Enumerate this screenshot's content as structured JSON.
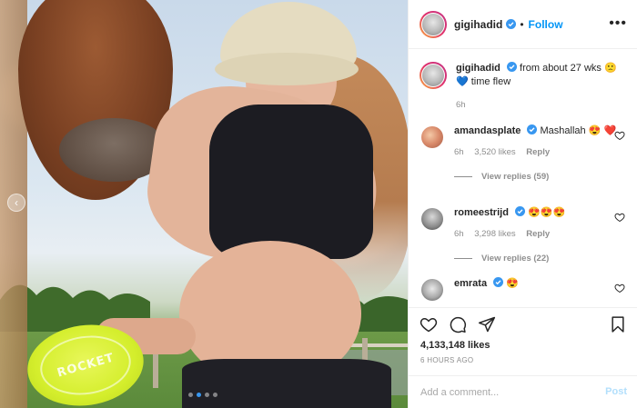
{
  "header": {
    "username": "gigihadid",
    "separator": "•",
    "follow_label": "Follow",
    "more_icon": "more-horizontal-icon"
  },
  "caption": {
    "username": "gigihadid",
    "text": "from about 27 wks 🙁 💙 time flew",
    "time": "6h"
  },
  "comments": [
    {
      "username": "amandasplate",
      "text": "Mashallah 😍 ❤️",
      "time": "6h",
      "likes": "3,520 likes",
      "reply_label": "Reply",
      "replies": "View replies (59)"
    },
    {
      "username": "romeestrijd",
      "text": "😍😍😍",
      "time": "6h",
      "likes": "3,298 likes",
      "reply_label": "Reply",
      "replies": "View replies (22)"
    },
    {
      "username": "emrata",
      "text": "😍"
    }
  ],
  "photo": {
    "frisbee_text": "ROCKET",
    "carousel_count": 4,
    "carousel_active_index": 1
  },
  "actions": {
    "likes": "4,133,148 likes",
    "timestamp": "6 HOURS AGO",
    "comment_placeholder": "Add a comment...",
    "post_label": "Post"
  },
  "colors": {
    "accent": "#0095f6",
    "verified": "#3897f0",
    "muted": "#8e8e8e",
    "post_disabled": "#b2dffc"
  },
  "icons": [
    "heart-icon",
    "comment-icon",
    "share-icon",
    "bookmark-icon",
    "verified-badge-icon",
    "chevron-left-icon"
  ]
}
